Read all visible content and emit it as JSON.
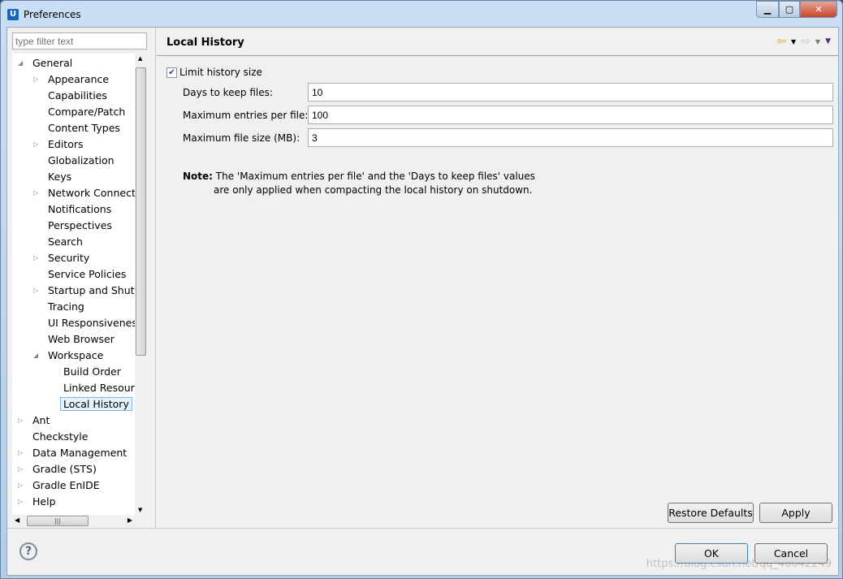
{
  "window": {
    "title": "Preferences",
    "app_icon": "U"
  },
  "filter": {
    "placeholder": "type filter text"
  },
  "tree": [
    {
      "label": "General",
      "level": 0,
      "expander": "expanded"
    },
    {
      "label": "Appearance",
      "level": 1,
      "expander": "collapsed"
    },
    {
      "label": "Capabilities",
      "level": 1,
      "expander": ""
    },
    {
      "label": "Compare/Patch",
      "level": 1,
      "expander": ""
    },
    {
      "label": "Content Types",
      "level": 1,
      "expander": ""
    },
    {
      "label": "Editors",
      "level": 1,
      "expander": "collapsed"
    },
    {
      "label": "Globalization",
      "level": 1,
      "expander": ""
    },
    {
      "label": "Keys",
      "level": 1,
      "expander": ""
    },
    {
      "label": "Network Connectio",
      "level": 1,
      "expander": "collapsed"
    },
    {
      "label": "Notifications",
      "level": 1,
      "expander": ""
    },
    {
      "label": "Perspectives",
      "level": 1,
      "expander": ""
    },
    {
      "label": "Search",
      "level": 1,
      "expander": ""
    },
    {
      "label": "Security",
      "level": 1,
      "expander": "collapsed"
    },
    {
      "label": "Service Policies",
      "level": 1,
      "expander": ""
    },
    {
      "label": "Startup and Shutd",
      "level": 1,
      "expander": "collapsed"
    },
    {
      "label": "Tracing",
      "level": 1,
      "expander": ""
    },
    {
      "label": "UI Responsiveness",
      "level": 1,
      "expander": ""
    },
    {
      "label": "Web Browser",
      "level": 1,
      "expander": ""
    },
    {
      "label": "Workspace",
      "level": 1,
      "expander": "expanded"
    },
    {
      "label": "Build Order",
      "level": 2,
      "expander": ""
    },
    {
      "label": "Linked Resourc",
      "level": 2,
      "expander": ""
    },
    {
      "label": "Local History",
      "level": 2,
      "expander": "",
      "selected": true
    },
    {
      "label": "Ant",
      "level": 0,
      "expander": "collapsed"
    },
    {
      "label": "Checkstyle",
      "level": 0,
      "expander": ""
    },
    {
      "label": "Data Management",
      "level": 0,
      "expander": "collapsed"
    },
    {
      "label": "Gradle (STS)",
      "level": 0,
      "expander": "collapsed"
    },
    {
      "label": "Gradle EnIDE",
      "level": 0,
      "expander": "collapsed"
    },
    {
      "label": "Help",
      "level": 0,
      "expander": "collapsed"
    }
  ],
  "page": {
    "title": "Local History",
    "limit_checkbox": {
      "label": "Limit history size",
      "checked": true
    },
    "fields": [
      {
        "label": "Days to keep files:",
        "value": "10"
      },
      {
        "label": "Maximum entries per file:",
        "value": "100"
      },
      {
        "label": "Maximum file size (MB):",
        "value": "3"
      }
    ],
    "note_label": "Note:",
    "note_line1": "The 'Maximum entries per file' and the 'Days to keep files' values",
    "note_line2": "are only applied when compacting the local history on shutdown.",
    "restore_defaults": "Restore Defaults",
    "apply": "Apply"
  },
  "footer": {
    "ok": "OK",
    "cancel": "Cancel",
    "help_icon": "?"
  },
  "watermark": "https://blog.csdn.net/qq_40642249",
  "colors": {
    "nav_back": "#e0a020",
    "nav_menu": "#4b2a7a",
    "selection": "#e5f3fb"
  }
}
